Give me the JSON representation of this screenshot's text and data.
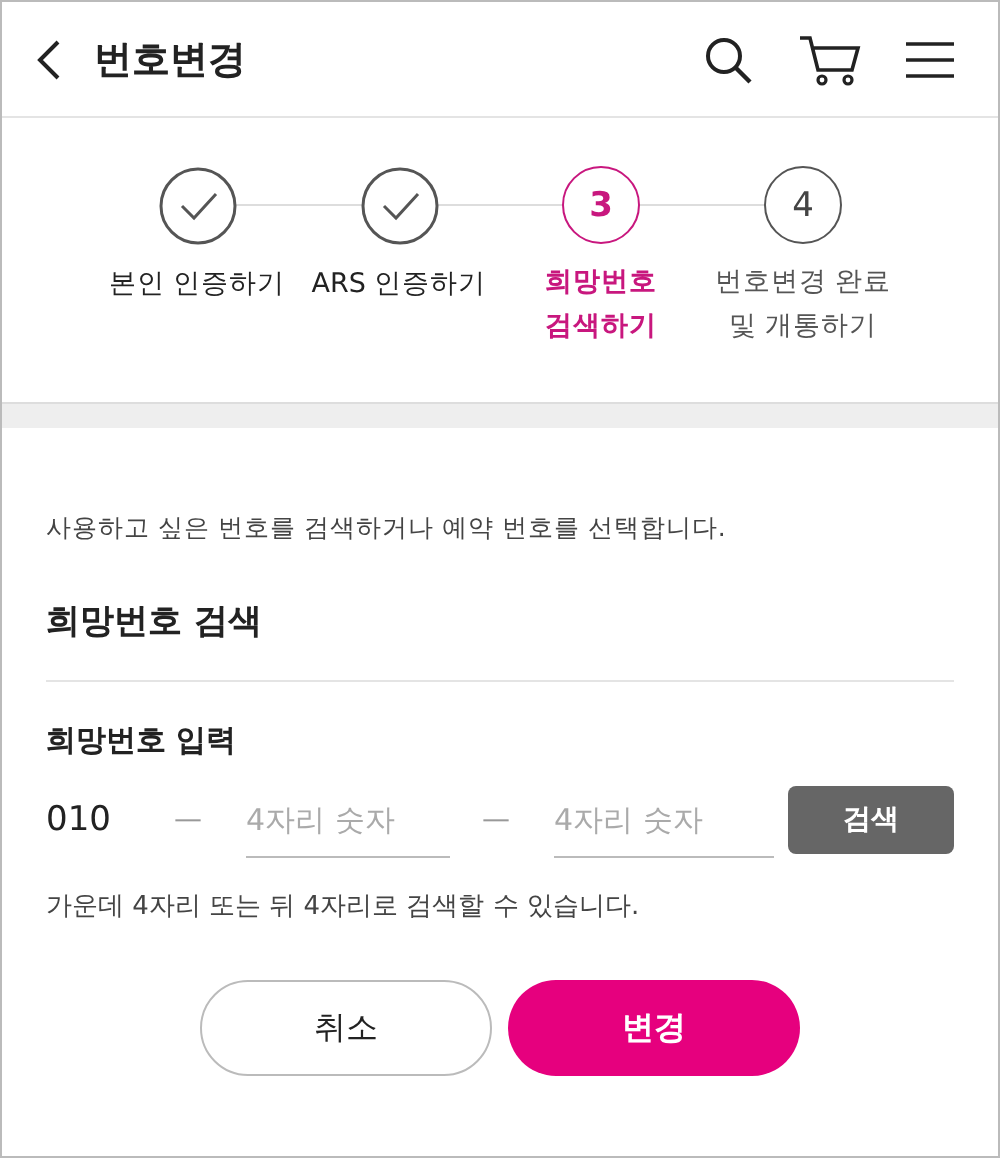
{
  "header": {
    "title": "번호변경"
  },
  "steps": [
    {
      "kind": "done",
      "label": "본인 인증하기"
    },
    {
      "kind": "done",
      "label": "ARS 인증하기"
    },
    {
      "kind": "current",
      "number": "3",
      "label": "희망번호 검색하기"
    },
    {
      "kind": "pending",
      "number": "4",
      "label": "번호변경 완료 및 개통하기"
    }
  ],
  "intro": "사용하고 싶은 번호를 검색하거나 예약 번호를 선택합니다.",
  "section_title": "희망번호 검색",
  "input_label": "희망번호 입력",
  "prefix": "010",
  "separator": "—",
  "fields": [
    {
      "placeholder": "4자리 숫자"
    },
    {
      "placeholder": "4자리 숫자"
    }
  ],
  "search_button": "검색",
  "hint": "가운데 4자리 또는 뒤 4자리로 검색할 수 있습니다.",
  "buttons": [
    {
      "kind": "secondary",
      "label": "취소"
    },
    {
      "kind": "primary",
      "label": "변경"
    }
  ]
}
